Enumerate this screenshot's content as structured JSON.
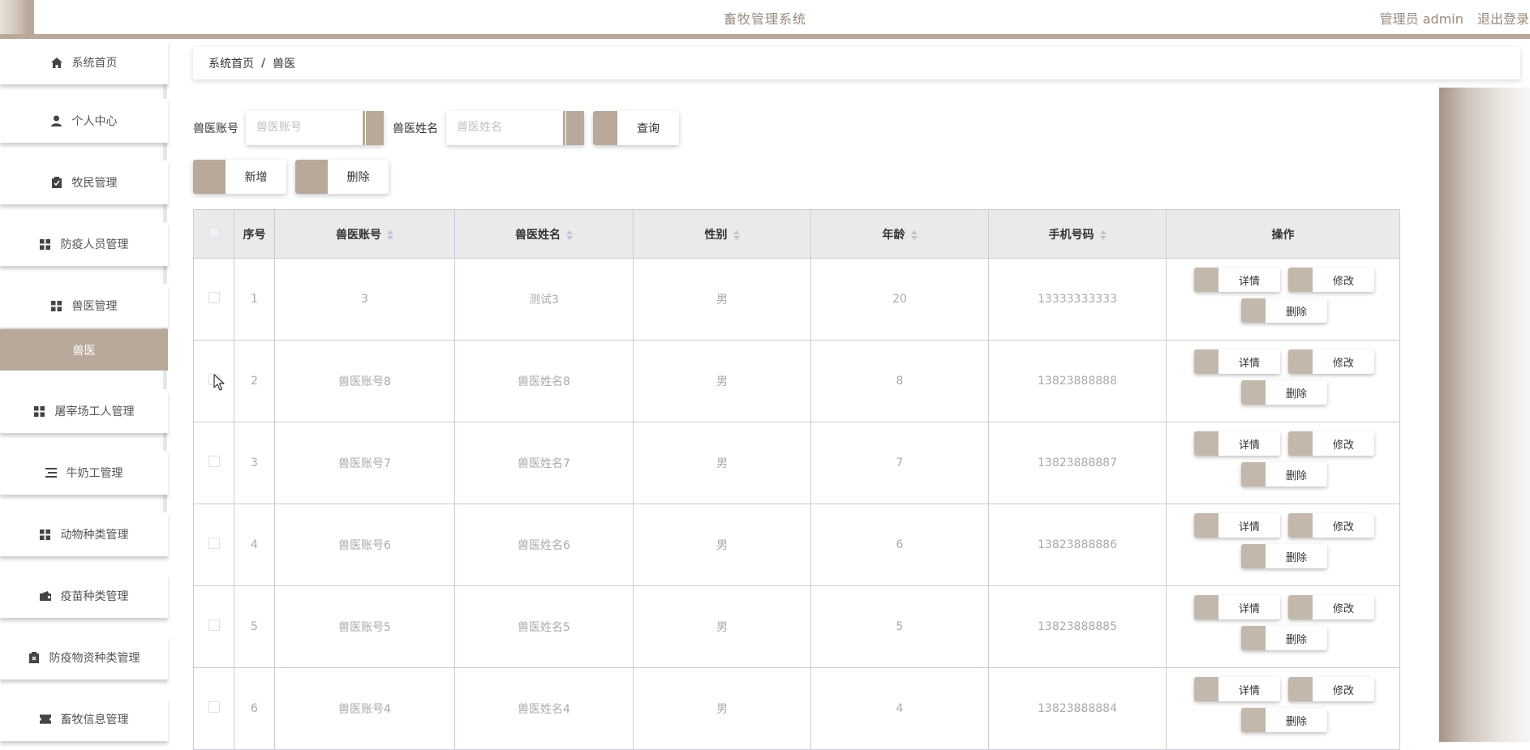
{
  "header": {
    "title": "畜牧管理系统",
    "user": "管理员 admin",
    "logout": "退出登录"
  },
  "sidebar": {
    "items": [
      {
        "label": "系统首页",
        "icon": "home-icon"
      },
      {
        "label": "个人中心",
        "icon": "user-icon"
      },
      {
        "label": "牧民管理",
        "icon": "clipboard-icon"
      },
      {
        "label": "防疫人员管理",
        "icon": "grid-icon"
      },
      {
        "label": "兽医管理",
        "icon": "grid-icon"
      },
      {
        "label": "屠宰场工人管理",
        "icon": "grid-icon"
      },
      {
        "label": "牛奶工管理",
        "icon": "list-icon"
      },
      {
        "label": "动物种类管理",
        "icon": "grid-icon"
      },
      {
        "label": "疫苗种类管理",
        "icon": "wallet-icon"
      },
      {
        "label": "防疫物资种类管理",
        "icon": "clipboard-x-icon"
      },
      {
        "label": "畜牧信息管理",
        "icon": "ticket-icon"
      }
    ],
    "active_sub": "兽医"
  },
  "breadcrumb": {
    "home": "系统首页",
    "sep": "/",
    "current": "兽医"
  },
  "search": {
    "account_label": "兽医账号",
    "account_placeholder": "兽医账号",
    "name_label": "兽医姓名",
    "name_placeholder": "兽医姓名",
    "query_button": "查询"
  },
  "actions": {
    "add": "新增",
    "delete": "删除"
  },
  "table": {
    "headers": [
      "序号",
      "兽医账号",
      "兽医姓名",
      "性别",
      "年龄",
      "手机号码",
      "操作"
    ],
    "op_labels": {
      "detail": "详情",
      "edit": "修改",
      "delete": "删除"
    },
    "rows": [
      {
        "index": "1",
        "account": "3",
        "name": "测试3",
        "gender": "男",
        "age": "20",
        "phone": "13333333333"
      },
      {
        "index": "2",
        "account": "兽医账号8",
        "name": "兽医姓名8",
        "gender": "男",
        "age": "8",
        "phone": "13823888888"
      },
      {
        "index": "3",
        "account": "兽医账号7",
        "name": "兽医姓名7",
        "gender": "男",
        "age": "7",
        "phone": "13823888887"
      },
      {
        "index": "4",
        "account": "兽医账号6",
        "name": "兽医姓名6",
        "gender": "男",
        "age": "6",
        "phone": "13823888886"
      },
      {
        "index": "5",
        "account": "兽医账号5",
        "name": "兽医姓名5",
        "gender": "男",
        "age": "5",
        "phone": "13823888885"
      },
      {
        "index": "6",
        "account": "兽医账号4",
        "name": "兽医姓名4",
        "gender": "男",
        "age": "4",
        "phone": "13823888884"
      }
    ]
  },
  "colors": {
    "accent": "#b8a99a",
    "header_text": "#9a8a7c"
  }
}
